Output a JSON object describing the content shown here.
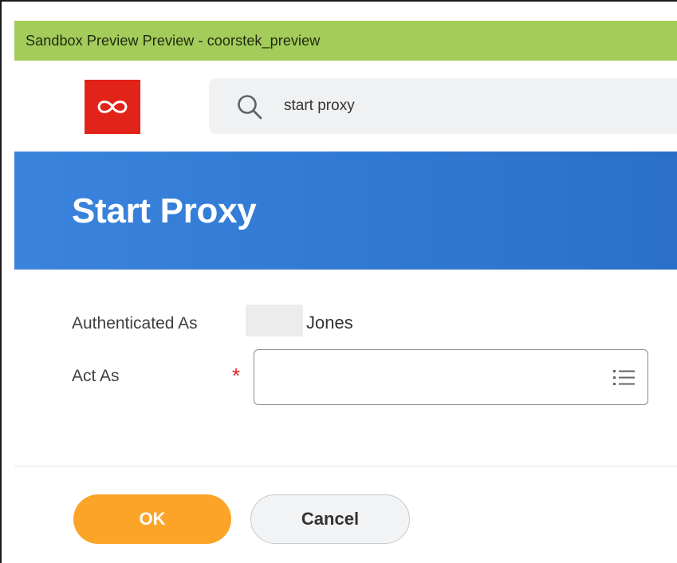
{
  "sandbox_banner": {
    "text": "Sandbox Preview Preview - coorstek_preview",
    "color": "#a3cc5a"
  },
  "header": {
    "logo": {
      "icon": "infinity-icon",
      "color": "#e2231a"
    },
    "search": {
      "icon": "search-icon",
      "value": "start proxy"
    }
  },
  "title_band": {
    "title": "Start Proxy",
    "color": "#2f78d2"
  },
  "form": {
    "authenticated_as": {
      "label": "Authenticated As",
      "value": "Jones"
    },
    "act_as": {
      "label": "Act As",
      "required_marker": "*",
      "value": "",
      "icon": "list-icon"
    }
  },
  "actions": {
    "ok_label": "OK",
    "cancel_label": "Cancel",
    "ok_color": "#fba428"
  }
}
